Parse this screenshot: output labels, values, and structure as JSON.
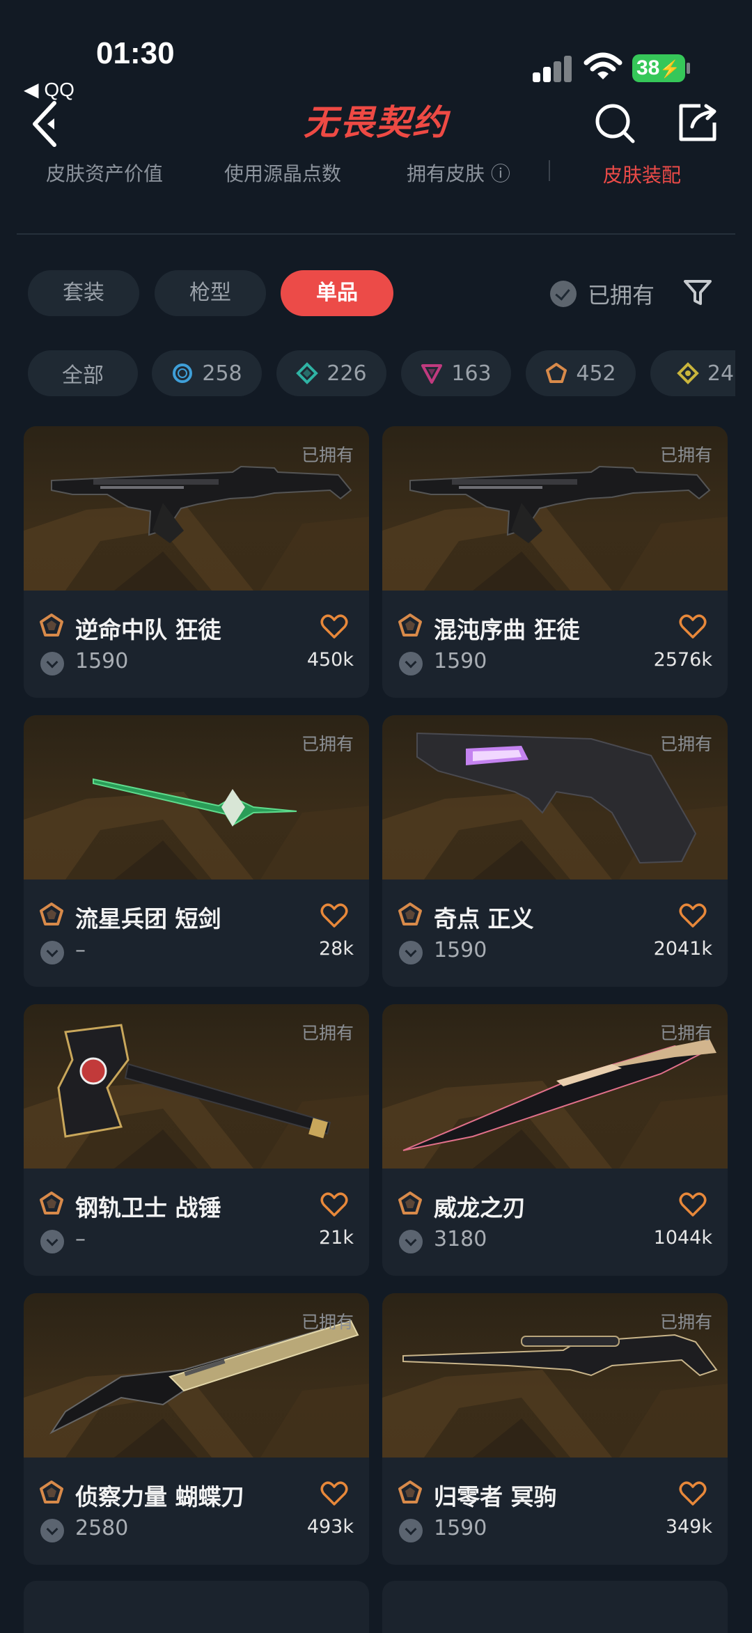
{
  "status_bar": {
    "time": "01:30",
    "back_app": "◀ QQ",
    "battery": "38"
  },
  "header": {
    "title": "无畏契约"
  },
  "stats_row": {
    "items": [
      "皮肤资产价值",
      "使用源晶点数",
      "拥有皮肤 ⓘ",
      "皮肤装配"
    ],
    "active_index": 3
  },
  "tabs": [
    {
      "label": "套装",
      "active": false
    },
    {
      "label": "枪型",
      "active": false
    },
    {
      "label": "单品",
      "active": true
    }
  ],
  "owned_filter": {
    "label": "已拥有"
  },
  "rarity_filters": [
    {
      "label": "全部"
    },
    {
      "count": "258",
      "color": "#3f9fd8",
      "shape": "circle-icon"
    },
    {
      "count": "226",
      "color": "#2fb3a4",
      "shape": "diamond-icon"
    },
    {
      "count": "163",
      "color": "#c03a7e",
      "shape": "triangle-icon"
    },
    {
      "count": "452",
      "color": "#d88a4a",
      "shape": "pentagon-icon"
    },
    {
      "count": "24",
      "color": "#c9b53c",
      "shape": "rhombus-icon"
    }
  ],
  "cards": [
    {
      "name": "逆命中队 狂徒",
      "price": "1590",
      "likes": "450k",
      "owned": "已拥有",
      "weapon": "rifle"
    },
    {
      "name": "混沌序曲 狂徒",
      "price": "1590",
      "likes": "2576k",
      "owned": "已拥有",
      "weapon": "rifle"
    },
    {
      "name": "流星兵团 短剑",
      "price": "–",
      "likes": "28k",
      "owned": "已拥有",
      "weapon": "dagger"
    },
    {
      "name": "奇点 正义",
      "price": "1590",
      "likes": "2041k",
      "owned": "已拥有",
      "weapon": "revolver"
    },
    {
      "name": "钢轨卫士 战锤",
      "price": "–",
      "likes": "21k",
      "owned": "已拥有",
      "weapon": "hammer"
    },
    {
      "name": "威龙之刃",
      "price": "3180",
      "likes": "1044k",
      "owned": "已拥有",
      "weapon": "blade"
    },
    {
      "name": "侦察力量 蝴蝶刀",
      "price": "2580",
      "likes": "493k",
      "owned": "已拥有",
      "weapon": "butterfly"
    },
    {
      "name": "归零者 冥驹",
      "price": "1590",
      "likes": "349k",
      "owned": "已拥有",
      "weapon": "sniper"
    }
  ],
  "colors": {
    "accent": "#ec4b48",
    "tier": "#d88a4a"
  }
}
